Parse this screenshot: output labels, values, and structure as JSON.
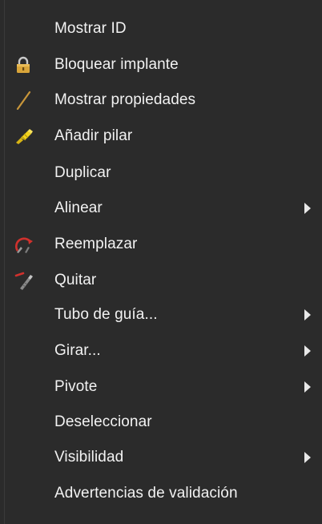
{
  "menu": {
    "items": [
      {
        "label": "Mostrar ID",
        "icon": null,
        "submenu": false
      },
      {
        "label": "Bloquear implante",
        "icon": "lock-icon",
        "submenu": false
      },
      {
        "label": "Mostrar propiedades",
        "icon": "pencil-line-icon",
        "submenu": false
      },
      {
        "label": "Añadir pilar",
        "icon": "abutment-icon",
        "submenu": false
      },
      {
        "label": "Duplicar",
        "icon": null,
        "submenu": false
      },
      {
        "label": "Alinear",
        "icon": null,
        "submenu": true
      },
      {
        "label": "Reemplazar",
        "icon": "replace-arrows-icon",
        "submenu": false
      },
      {
        "label": "Quitar",
        "icon": "remove-implant-icon",
        "submenu": false
      },
      {
        "label": "Tubo de guía...",
        "icon": null,
        "submenu": true
      },
      {
        "label": "Girar...",
        "icon": null,
        "submenu": true
      },
      {
        "label": "Pivote",
        "icon": null,
        "submenu": true
      },
      {
        "label": "Deseleccionar",
        "icon": null,
        "submenu": false
      },
      {
        "label": "Visibilidad",
        "icon": null,
        "submenu": true
      },
      {
        "label": "Advertencias de validación",
        "icon": null,
        "submenu": false
      }
    ]
  },
  "colors": {
    "background": "#2b2b2b",
    "text": "#f2f2f2",
    "lock": "#d9a53a",
    "pencil": "#c8963a",
    "abutment": "#f2d21b",
    "replace": "#d0312d"
  }
}
